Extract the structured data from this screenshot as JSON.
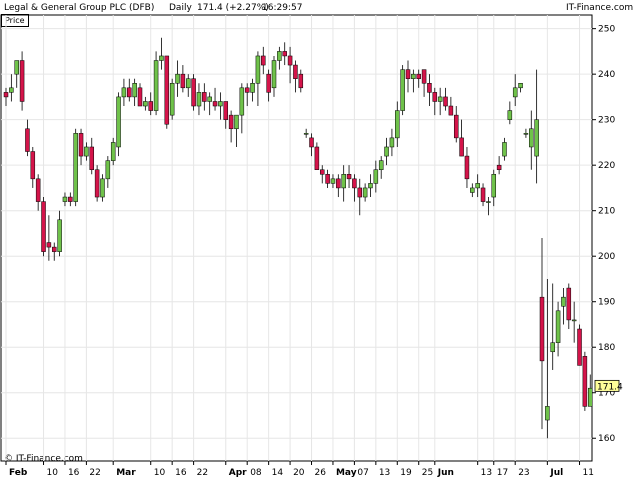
{
  "header": {
    "title": "Legal & General Group PLC (DFB)",
    "period": "Daily",
    "last": "171.4 (+2.27%)",
    "time": "16:29:57",
    "brand": "IT-Finance.com"
  },
  "price_box": "Price",
  "watermark": "© IT-Finance.com",
  "last_price_label": "171.4",
  "colors": {
    "up": "#6fc24a",
    "down": "#d4144a",
    "grid": "#e6e6e6",
    "last_bg": "#ffff99"
  },
  "chart_data": {
    "type": "candlestick",
    "title": "Legal & General Group PLC (DFB)",
    "ylim": [
      155,
      253
    ],
    "yticks": [
      160,
      170,
      180,
      190,
      200,
      210,
      220,
      230,
      240,
      250
    ],
    "grid": true,
    "x_ticks": [
      {
        "label": "Feb",
        "index": 0,
        "bold": true
      },
      {
        "label": "10",
        "index": 7,
        "bold": false
      },
      {
        "label": "16",
        "index": 11,
        "bold": false
      },
      {
        "label": "22",
        "index": 15,
        "bold": false
      },
      {
        "label": "Mar",
        "index": 20,
        "bold": true
      },
      {
        "label": "10",
        "index": 27,
        "bold": false
      },
      {
        "label": "16",
        "index": 31,
        "bold": false
      },
      {
        "label": "22",
        "index": 35,
        "bold": false
      },
      {
        "label": "Apr",
        "index": 41,
        "bold": true
      },
      {
        "label": "08",
        "index": 45,
        "bold": false
      },
      {
        "label": "14",
        "index": 49,
        "bold": false
      },
      {
        "label": "20",
        "index": 53,
        "bold": false
      },
      {
        "label": "26",
        "index": 57,
        "bold": false
      },
      {
        "label": "May",
        "index": 61,
        "bold": true
      },
      {
        "label": "07",
        "index": 65,
        "bold": false
      },
      {
        "label": "13",
        "index": 69,
        "bold": false
      },
      {
        "label": "19",
        "index": 73,
        "bold": false
      },
      {
        "label": "25",
        "index": 77,
        "bold": false
      },
      {
        "label": "Jun",
        "index": 80,
        "bold": true
      },
      {
        "label": "13",
        "index": 88,
        "bold": false
      },
      {
        "label": "17",
        "index": 91,
        "bold": false
      },
      {
        "label": "23",
        "index": 95,
        "bold": false
      },
      {
        "label": "Jul",
        "index": 101,
        "bold": true
      },
      {
        "label": "11",
        "index": 107,
        "bold": false
      }
    ],
    "candles": [
      [
        236,
        237,
        233,
        235
      ],
      [
        236,
        240,
        234,
        237
      ],
      [
        240,
        243,
        237,
        243
      ],
      [
        243,
        245,
        232,
        234
      ],
      [
        228,
        230,
        222,
        223
      ],
      [
        223,
        224,
        215,
        217
      ],
      [
        217,
        218,
        210,
        212
      ],
      [
        212,
        213,
        200,
        201
      ],
      [
        203,
        209,
        199,
        202
      ],
      [
        202,
        203,
        199,
        201
      ],
      [
        201,
        210,
        200,
        208
      ],
      [
        212,
        214,
        211,
        213
      ],
      [
        213,
        214,
        211,
        212
      ],
      [
        212,
        228,
        211,
        227
      ],
      [
        227,
        228,
        220,
        222
      ],
      [
        222,
        225,
        221,
        224
      ],
      [
        224,
        226,
        218,
        219
      ],
      [
        219,
        220,
        212,
        213
      ],
      [
        213,
        218,
        212,
        217
      ],
      [
        217,
        222,
        215,
        221
      ],
      [
        221,
        226,
        220,
        225
      ],
      [
        224,
        236,
        222,
        235
      ],
      [
        235,
        239,
        233,
        237
      ],
      [
        237,
        239,
        234,
        235
      ],
      [
        235,
        239,
        233,
        238
      ],
      [
        237,
        238,
        233,
        233
      ],
      [
        233,
        235,
        232,
        234
      ],
      [
        234,
        236,
        231,
        232
      ],
      [
        232,
        245,
        231,
        243
      ],
      [
        243,
        248,
        241,
        244
      ],
      [
        244,
        244,
        228,
        229
      ],
      [
        231,
        239,
        230,
        238
      ],
      [
        238,
        243,
        235,
        240
      ],
      [
        240,
        242,
        236,
        237
      ],
      [
        237,
        240,
        235,
        239
      ],
      [
        239,
        240,
        232,
        233
      ],
      [
        233,
        238,
        231,
        236
      ],
      [
        236,
        238,
        232,
        234
      ],
      [
        234,
        236,
        231,
        235
      ],
      [
        234,
        237,
        232,
        233
      ],
      [
        233,
        236,
        230,
        234
      ],
      [
        234,
        234,
        228,
        230
      ],
      [
        231,
        232,
        225,
        228
      ],
      [
        228,
        230,
        224,
        231
      ],
      [
        231,
        238,
        227,
        237
      ],
      [
        237,
        238,
        233,
        236
      ],
      [
        236,
        239,
        234,
        238
      ],
      [
        238,
        245,
        233,
        244
      ],
      [
        244,
        246,
        240,
        242
      ],
      [
        240,
        241,
        234,
        236
      ],
      [
        237,
        244,
        235,
        243
      ],
      [
        243,
        246,
        241,
        245
      ],
      [
        245,
        247,
        242,
        244
      ],
      [
        244,
        246,
        238,
        242
      ],
      [
        242,
        243,
        236,
        239
      ],
      [
        240,
        241,
        236,
        237
      ],
      [
        227,
        228,
        226,
        227
      ],
      [
        226,
        227,
        222,
        224
      ],
      [
        224,
        225,
        219,
        219
      ],
      [
        219,
        220,
        216,
        218
      ],
      [
        218,
        219,
        215,
        216
      ],
      [
        216,
        218,
        215,
        217
      ],
      [
        217,
        218,
        213,
        215
      ],
      [
        215,
        220,
        212,
        218
      ],
      [
        218,
        220,
        215,
        217
      ],
      [
        217,
        218,
        212,
        215
      ],
      [
        215,
        217,
        209,
        213
      ],
      [
        213,
        216,
        212,
        215
      ],
      [
        215,
        218,
        213,
        216
      ],
      [
        216,
        221,
        214,
        219
      ],
      [
        219,
        222,
        217,
        221
      ],
      [
        222,
        226,
        220,
        224
      ],
      [
        224,
        228,
        222,
        226
      ],
      [
        226,
        234,
        224,
        232
      ],
      [
        232,
        242,
        231,
        241
      ],
      [
        241,
        243,
        236,
        239
      ],
      [
        239,
        241,
        236,
        240
      ],
      [
        240,
        241,
        237,
        239
      ],
      [
        241,
        241,
        235,
        238
      ],
      [
        238,
        240,
        233,
        236
      ],
      [
        236,
        237,
        231,
        234
      ],
      [
        234,
        237,
        231,
        235
      ],
      [
        235,
        237,
        232,
        233
      ],
      [
        233,
        235,
        231,
        231
      ],
      [
        231,
        233,
        225,
        226
      ],
      [
        226,
        230,
        222,
        222
      ],
      [
        222,
        224,
        215,
        217
      ],
      [
        214,
        216,
        213,
        215
      ],
      [
        215,
        218,
        213,
        216
      ],
      [
        215,
        216,
        211,
        212
      ],
      [
        212,
        213,
        209,
        212
      ],
      [
        213,
        219,
        211,
        218
      ],
      [
        220,
        222,
        218,
        219
      ],
      [
        222,
        226,
        221,
        225
      ],
      [
        230,
        234,
        229,
        232
      ],
      [
        235,
        240,
        233,
        237
      ],
      [
        237,
        238,
        236,
        238
      ],
      [
        227,
        228,
        226,
        227
      ],
      [
        224,
        232,
        219,
        228
      ],
      [
        222,
        241,
        216,
        230
      ],
      [
        191,
        204,
        162,
        177
      ],
      [
        164,
        195,
        160,
        167
      ],
      [
        179,
        194,
        175,
        181
      ],
      [
        181,
        190,
        178,
        188
      ],
      [
        189,
        193,
        185,
        191
      ],
      [
        193,
        194,
        184,
        186
      ],
      [
        186,
        190,
        181,
        186
      ],
      [
        184,
        185,
        176,
        176
      ],
      [
        178,
        179,
        166,
        167
      ],
      [
        167,
        174,
        167,
        171
      ]
    ]
  }
}
